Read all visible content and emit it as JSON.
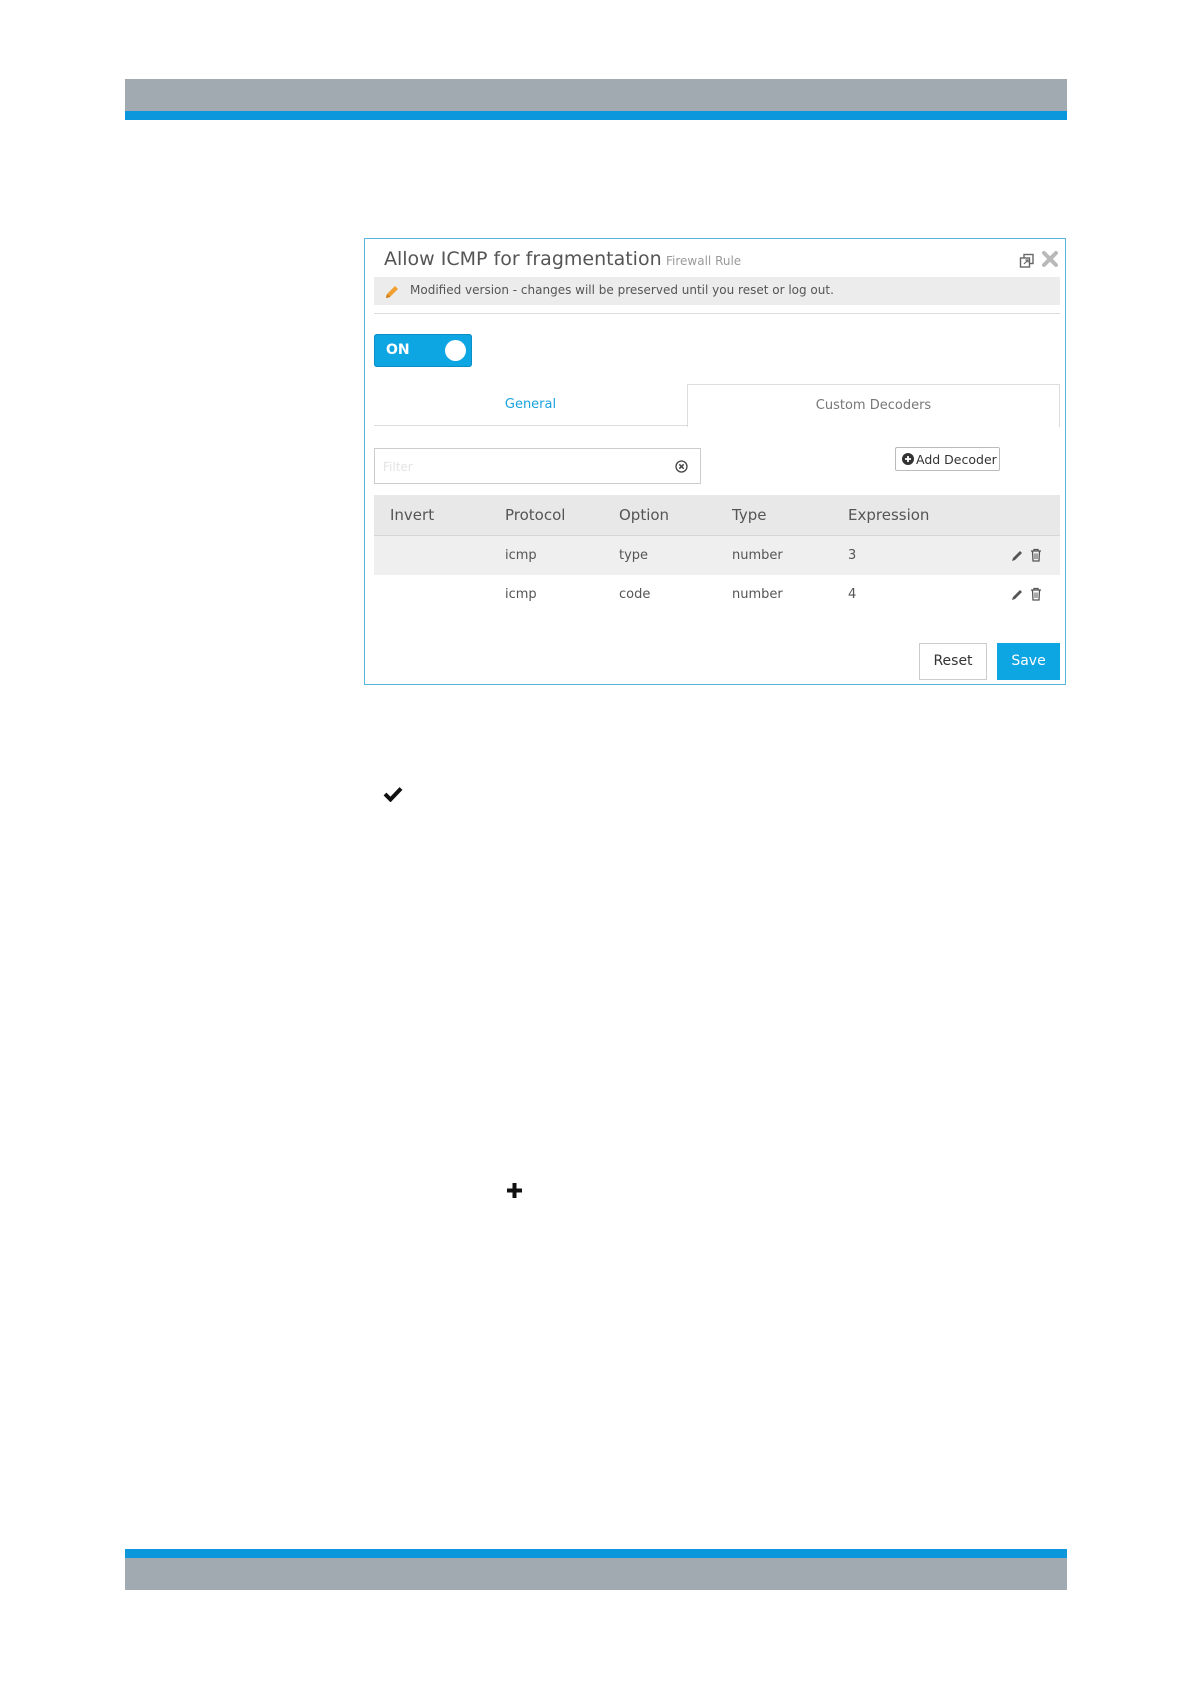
{
  "dialog": {
    "title": "Allow ICMP for fragmentation",
    "subtitle": "Firewall Rule",
    "popout_icon": "popout-icon",
    "close_icon": "close-icon",
    "notice": {
      "icon": "pencil-icon",
      "icon_color": "#f0a030",
      "text": "Modified version - changes will be preserved until you reset or log out."
    },
    "toggle": {
      "label": "ON",
      "state": "on",
      "color": "#0ea5e3"
    },
    "tabs": [
      {
        "label": "General",
        "active": false
      },
      {
        "label": "Custom Decoders",
        "active": true
      }
    ],
    "filter": {
      "placeholder": "Filter",
      "value": ""
    },
    "add_decoder_label": "Add Decoder",
    "table": {
      "columns": [
        "Invert",
        "Protocol",
        "Option",
        "Type",
        "Expression"
      ],
      "rows": [
        {
          "invert": "",
          "protocol": "icmp",
          "option": "type",
          "type": "number",
          "expression": "3"
        },
        {
          "invert": "",
          "protocol": "icmp",
          "option": "code",
          "type": "number",
          "expression": "4"
        }
      ]
    },
    "reset_label": "Reset",
    "save_label": "Save",
    "accent_color": "#0ea5e3"
  },
  "page_glyphs": {
    "check": "checkmark-icon",
    "plus": "plus-icon"
  }
}
